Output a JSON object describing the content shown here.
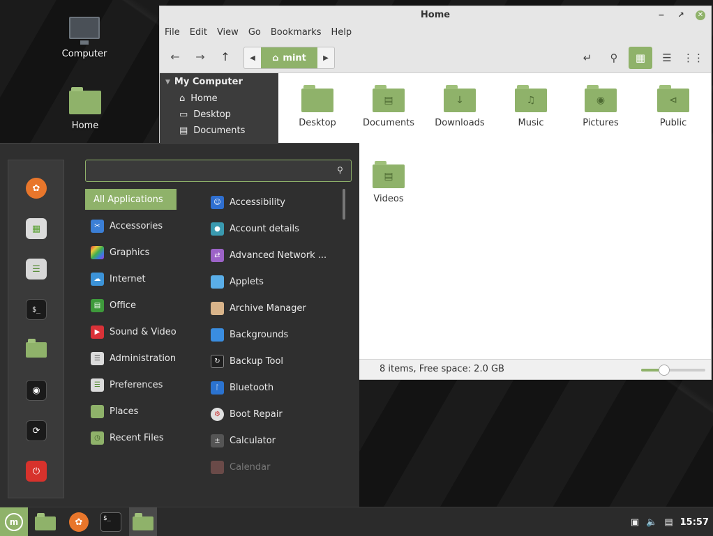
{
  "colors": {
    "accent": "#8fb26a",
    "panel": "#2b2b2b",
    "menu": "#2f2f2f"
  },
  "desktop": {
    "icons": [
      {
        "label": "Computer",
        "icon": "computer-icon"
      },
      {
        "label": "Home",
        "icon": "home-folder-icon"
      }
    ]
  },
  "file_manager": {
    "title": "Home",
    "menus": [
      "File",
      "Edit",
      "View",
      "Go",
      "Bookmarks",
      "Help"
    ],
    "path": "mint",
    "sidebar": {
      "heading": "My Computer",
      "items": [
        "Home",
        "Desktop",
        "Documents"
      ]
    },
    "items": [
      {
        "name": "Desktop",
        "icon": "folder-icon"
      },
      {
        "name": "Documents",
        "icon": "documents-folder-icon"
      },
      {
        "name": "Downloads",
        "icon": "downloads-folder-icon"
      },
      {
        "name": "Music",
        "icon": "music-folder-icon"
      },
      {
        "name": "Pictures",
        "icon": "pictures-folder-icon"
      },
      {
        "name": "Public",
        "icon": "public-folder-icon"
      },
      {
        "name": "Videos",
        "icon": "videos-folder-icon"
      }
    ],
    "status": "8 items, Free space: 2.0 GB",
    "zoom_level": 0.36
  },
  "menu": {
    "search_value": "",
    "categories": [
      "All Applications",
      "Accessories",
      "Graphics",
      "Internet",
      "Office",
      "Sound & Video",
      "Administration",
      "Preferences",
      "Places",
      "Recent Files"
    ],
    "apps": [
      "Accessibility",
      "Account details",
      "Advanced Network ...",
      "Applets",
      "Archive Manager",
      "Backgrounds",
      "Backup Tool",
      "Bluetooth",
      "Boot Repair",
      "Calculator",
      "Calendar"
    ],
    "favorites": [
      "firefox-icon",
      "software-manager-icon",
      "settings-icon",
      "terminal-icon",
      "folder-icon",
      "lock-icon",
      "logout-icon",
      "power-icon"
    ]
  },
  "panel": {
    "launchers": [
      "menu-icon",
      "files-icon",
      "firefox-icon",
      "terminal-icon",
      "folder-icon"
    ],
    "clock": "15:57"
  }
}
